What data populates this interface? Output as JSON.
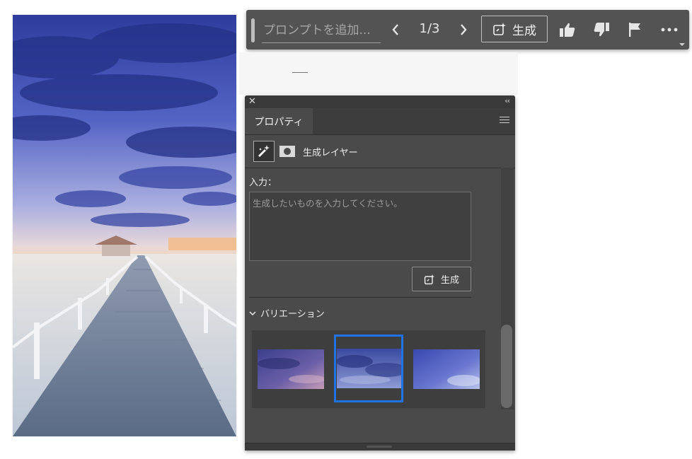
{
  "taskbar": {
    "prompt_placeholder": "プロンプトを追加...",
    "counter": "1/3",
    "generate_label": "生成",
    "icons": [
      "chevron-left-icon",
      "chevron-right-icon",
      "generate-icon",
      "thumbs-up-icon",
      "thumbs-down-icon",
      "flag-icon",
      "more-icon"
    ]
  },
  "panel": {
    "tab_label": "プロパティ",
    "layer_label": "生成レイヤー",
    "input_label": "入力：",
    "prompt_placeholder": "生成したいものを入力してください。",
    "prompt_value": "",
    "generate_label": "生成",
    "variations_label": "バリエーション",
    "variations_count": 3,
    "selected_variation": 2
  },
  "colors": {
    "taskbar_bg": "#535353",
    "panel_bg": "#4a4a4a",
    "selection": "#1f73e6"
  }
}
